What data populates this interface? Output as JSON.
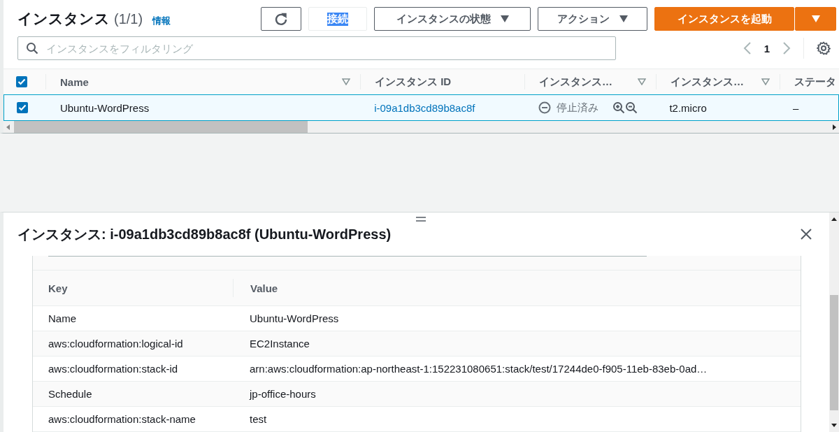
{
  "header": {
    "title": "インスタンス",
    "count": "(1/1)",
    "info_link": "情報"
  },
  "toolbar": {
    "connect": {
      "label": "接続",
      "text_selected": true
    },
    "state_menu": "インスタンスの状態",
    "actions_menu": "アクション",
    "launch": "インスタンスを起動"
  },
  "filter": {
    "placeholder": "インスタンスをフィルタリング"
  },
  "pagination": {
    "page": "1"
  },
  "table": {
    "select_all_checked": true,
    "columns": [
      {
        "label": "Name",
        "sortable": true
      },
      {
        "label": "インスタンス ID",
        "sortable": false
      },
      {
        "label": "インスタンス…",
        "sortable": true
      },
      {
        "label": "インスタンス…",
        "sortable": true
      },
      {
        "label": "ステータ",
        "sortable": false
      }
    ],
    "rows": [
      {
        "checked": true,
        "selected": true,
        "name": "Ubuntu-WordPress",
        "instance_id": "i-09a1db3cd89b8ac8f",
        "state": "停止済み",
        "type": "t2.micro",
        "status": "–"
      }
    ]
  },
  "details": {
    "title": "インスタンス: i-09a1db3cd89b8ac8f (Ubuntu-WordPress)",
    "tags": {
      "columns": [
        "Key",
        "Value"
      ],
      "rows": [
        {
          "key": "Name",
          "value": "Ubuntu-WordPress"
        },
        {
          "key": "aws:cloudformation:logical-id",
          "value": "EC2Instance"
        },
        {
          "key": "aws:cloudformation:stack-id",
          "value": "arn:aws:cloudformation:ap-northeast-1:152231080651:stack/test/17244de0-f905-11eb-83eb-0ad…"
        },
        {
          "key": "Schedule",
          "value": "jp-office-hours"
        },
        {
          "key": "aws:cloudformation:stack-name",
          "value": "test"
        }
      ]
    }
  }
}
